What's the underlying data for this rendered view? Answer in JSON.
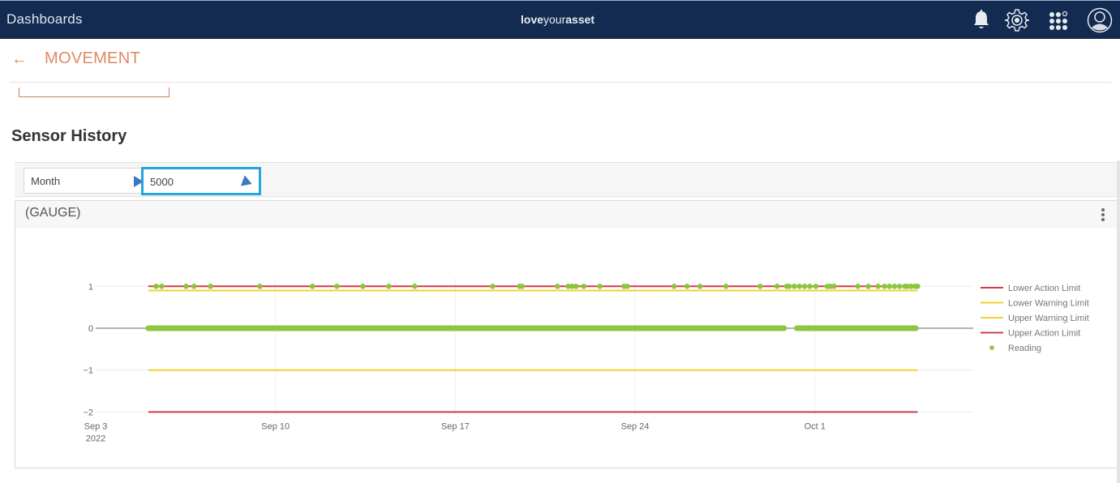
{
  "topbar": {
    "app_title": "Dashboards",
    "brand_bold1": "love",
    "brand_light": "your",
    "brand_bold2": "asset",
    "icons": [
      "bell-icon",
      "gear-icon",
      "app-grid-icon",
      "user-avatar-icon"
    ]
  },
  "page": {
    "back_icon": "←",
    "title": "MOVEMENT"
  },
  "section": {
    "title": "Sensor History"
  },
  "filters": {
    "period": "Month",
    "limit": "5000"
  },
  "card": {
    "title": "(GAUGE)"
  },
  "colors": {
    "topbar": "#132b50",
    "accent": "#e08a62",
    "action_limit": "#d23a4a",
    "warning_limit": "#f2d22e",
    "reading": "#8cc63f",
    "focus": "#27a3df"
  },
  "chart_data": {
    "type": "scatter",
    "title": "(GAUGE)",
    "xlabel": "",
    "ylabel": "",
    "x_ticks": [
      "Sep 3\n2022",
      "Sep 10",
      "Sep 17",
      "Sep 24",
      "Oct 1"
    ],
    "x_tick_days": [
      0,
      7,
      14,
      21,
      28
    ],
    "x_range_days": [
      0,
      35
    ],
    "y_ticks": [
      1,
      0,
      -1,
      -2
    ],
    "ylim": [
      -2.15,
      1.5
    ],
    "grid": true,
    "legend_position": "right",
    "series": [
      {
        "name": "Lower Action Limit",
        "kind": "line",
        "color": "#d23a4a",
        "y": -2,
        "x_start_day": 2.05,
        "x_end_day": 32.0
      },
      {
        "name": "Lower Warning Limit",
        "kind": "line",
        "color": "#f2d22e",
        "y": -1,
        "x_start_day": 2.05,
        "x_end_day": 32.0
      },
      {
        "name": "Upper Warning Limit",
        "kind": "line",
        "color": "#f2d22e",
        "y": 0.9,
        "x_start_day": 2.05,
        "x_end_day": 32.0
      },
      {
        "name": "Upper Action Limit",
        "kind": "line",
        "color": "#d23a4a",
        "y": 1,
        "x_start_day": 2.05,
        "x_end_day": 32.0
      },
      {
        "name": "Reading",
        "kind": "points",
        "color": "#8cc63f",
        "upper_points_day": [
          2.35,
          2.57,
          3.52,
          3.83,
          4.47,
          6.39,
          8.44,
          9.39,
          10.4,
          11.41,
          12.42,
          15.45,
          16.5,
          16.6,
          17.98,
          18.4,
          18.55,
          18.7,
          19.0,
          19.63,
          20.57,
          20.7,
          22.52,
          23.02,
          23.53,
          24.54,
          25.87,
          26.53,
          26.9,
          27.0,
          27.2,
          27.4,
          27.6,
          27.8,
          28.04,
          28.48,
          28.6,
          28.75,
          29.67,
          30.08,
          30.46,
          30.71,
          30.9,
          31.1,
          31.3,
          31.5,
          31.6,
          31.75,
          31.9,
          32.0
        ],
        "zero_segments_day": [
          [
            2.05,
            26.8
          ],
          [
            27.3,
            31.93
          ]
        ]
      }
    ]
  }
}
